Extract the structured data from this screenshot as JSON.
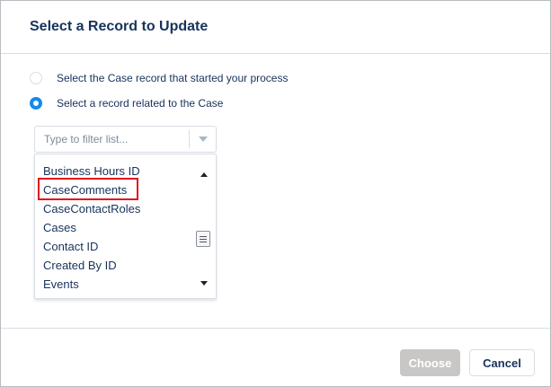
{
  "modal": {
    "title": "Select a Record to Update"
  },
  "options": [
    {
      "label": "Select the Case record that started your process",
      "selected": false
    },
    {
      "label": "Select a record related to the Case",
      "selected": true
    }
  ],
  "filter": {
    "placeholder": "Type to filter list..."
  },
  "list": {
    "items": [
      "Business Hours ID",
      "CaseComments",
      "CaseContactRoles",
      "Cases",
      "Contact ID",
      "Created By ID",
      "Events"
    ],
    "highlighted_item": "CaseComments",
    "highlight_color": "#e0141e"
  },
  "footer": {
    "choose_label": "Choose",
    "cancel_label": "Cancel"
  },
  "colors": {
    "accent": "#1589ee",
    "text": "#16325c",
    "disabled_button": "#c9c7c5"
  }
}
